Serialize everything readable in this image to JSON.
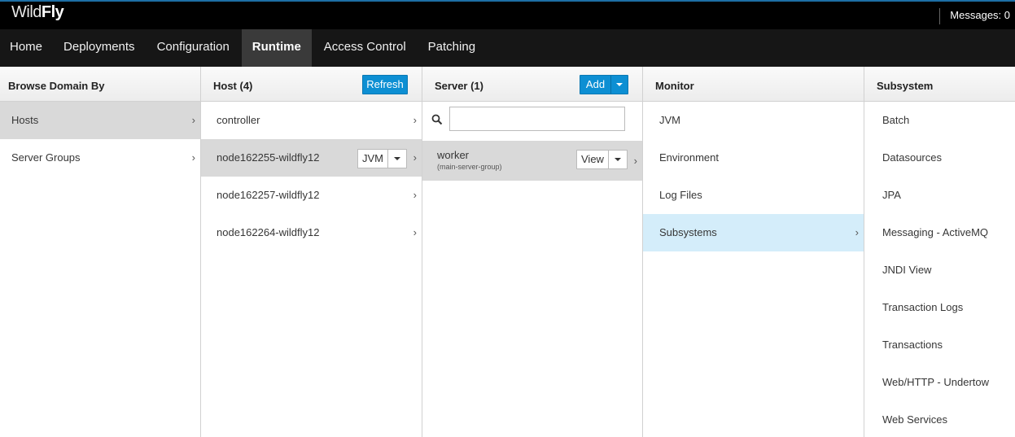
{
  "app": {
    "logo_thin": "Wild",
    "logo_bold": "Fly",
    "messages": "Messages: 0"
  },
  "nav": {
    "items": [
      {
        "label": "Home",
        "active": false
      },
      {
        "label": "Deployments",
        "active": false
      },
      {
        "label": "Configuration",
        "active": false
      },
      {
        "label": "Runtime",
        "active": true
      },
      {
        "label": "Access Control",
        "active": false
      },
      {
        "label": "Patching",
        "active": false
      }
    ]
  },
  "browse": {
    "title": "Browse Domain By",
    "items": [
      {
        "label": "Hosts",
        "selected": true
      },
      {
        "label": "Server Groups",
        "selected": false
      }
    ]
  },
  "hosts": {
    "title": "Host (4)",
    "refresh_label": "Refresh",
    "items": [
      {
        "label": "controller",
        "selected": false
      },
      {
        "label": "node162255-wildfly12",
        "selected": true
      },
      {
        "label": "node162257-wildfly12",
        "selected": false
      },
      {
        "label": "node162264-wildfly12",
        "selected": false
      }
    ],
    "selected_action": "JVM"
  },
  "servers": {
    "title": "Server (1)",
    "add_label": "Add",
    "search_placeholder": "",
    "items": [
      {
        "name": "worker",
        "group": "(main-server-group)",
        "action": "View"
      }
    ]
  },
  "monitor": {
    "title": "Monitor",
    "items": [
      {
        "label": "JVM",
        "selected": false
      },
      {
        "label": "Environment",
        "selected": false
      },
      {
        "label": "Log Files",
        "selected": false
      },
      {
        "label": "Subsystems",
        "selected": true
      }
    ]
  },
  "subsystem": {
    "title": "Subsystem",
    "items": [
      {
        "label": "Batch"
      },
      {
        "label": "Datasources"
      },
      {
        "label": "JPA"
      },
      {
        "label": "Messaging - ActiveMQ"
      },
      {
        "label": "JNDI View"
      },
      {
        "label": "Transaction Logs"
      },
      {
        "label": "Transactions"
      },
      {
        "label": "Web/HTTP - Undertow"
      },
      {
        "label": "Web Services"
      }
    ]
  },
  "colors": {
    "accent": "#0d8fd3",
    "selected_gray": "#d9d9d9",
    "selected_blue": "#d4edfa",
    "nav_bg": "#161616"
  }
}
